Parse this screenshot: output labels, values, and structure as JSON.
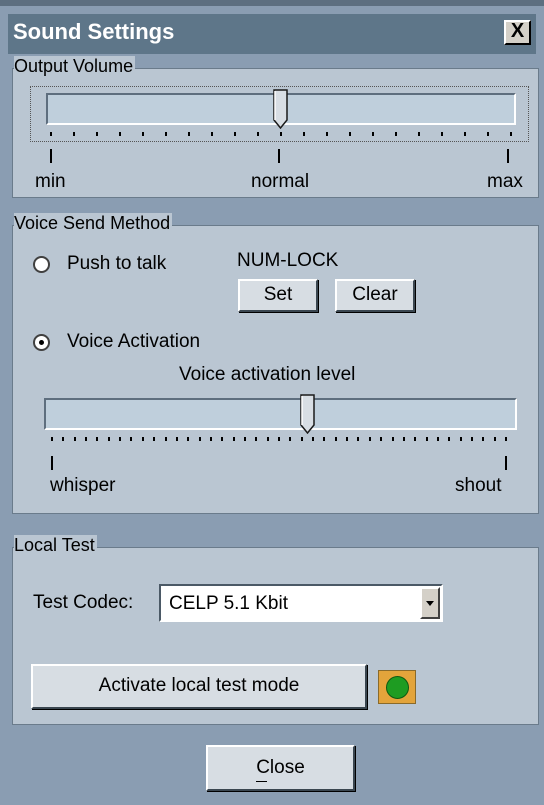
{
  "window": {
    "title": "Sound Settings",
    "close_glyph": "X"
  },
  "output_volume": {
    "legend": "Output Volume",
    "level": 0.5,
    "labels": {
      "min": "min",
      "normal": "normal",
      "max": "max"
    }
  },
  "voice_send": {
    "legend": "Voice Send Method",
    "push_to_talk": {
      "label": "Push to talk",
      "selected": false,
      "hotkey": "NUM-LOCK",
      "set_label": "Set",
      "clear_label": "Clear"
    },
    "voice_activation": {
      "label": "Voice Activation",
      "selected": true,
      "level_caption": "Voice activation level",
      "level": 0.56
    },
    "labels": {
      "min": "whisper",
      "max": "shout"
    }
  },
  "local_test": {
    "legend": "Local Test",
    "codec_label": "Test Codec:",
    "codec_value": "CELP 5.1 Kbit",
    "activate_label": "Activate local test mode",
    "indicator_color": "#1e9c22"
  },
  "footer": {
    "close_label": "Close"
  },
  "colors": {
    "titlebar": "#5e7689",
    "panel": "#bac6d2",
    "window": "#8a9db2"
  }
}
